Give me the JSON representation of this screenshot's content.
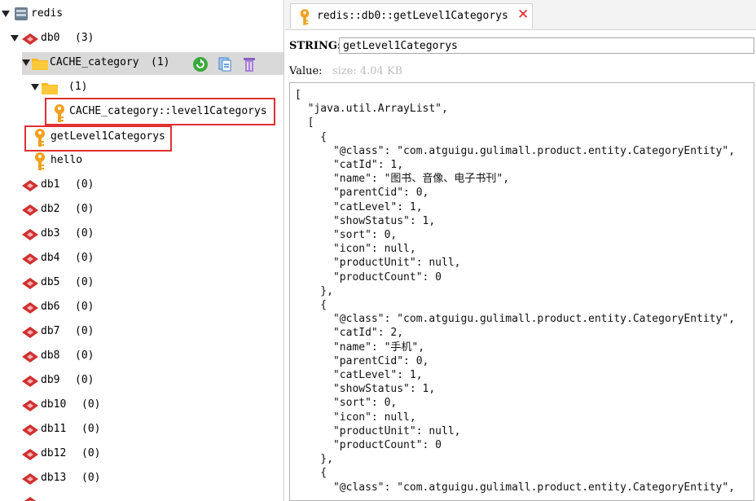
{
  "tree": {
    "root_label": "redis",
    "db0": {
      "label": "db0",
      "count": "(3)"
    },
    "cache_folder": {
      "label": "CACHE_category",
      "count": "(1)"
    },
    "sub_folder": {
      "count": "(1)"
    },
    "level1_key": "CACHE_category::level1Categorys",
    "getlevel_key": "getLevel1Categorys",
    "hello_key": "hello",
    "databases": [
      {
        "label": "db1",
        "count": "(0)"
      },
      {
        "label": "db2",
        "count": "(0)"
      },
      {
        "label": "db3",
        "count": "(0)"
      },
      {
        "label": "db4",
        "count": "(0)"
      },
      {
        "label": "db5",
        "count": "(0)"
      },
      {
        "label": "db6",
        "count": "(0)"
      },
      {
        "label": "db7",
        "count": "(0)"
      },
      {
        "label": "db8",
        "count": "(0)"
      },
      {
        "label": "db9",
        "count": "(0)"
      },
      {
        "label": "db10",
        "count": "(0)"
      },
      {
        "label": "db11",
        "count": "(0)"
      },
      {
        "label": "db12",
        "count": "(0)"
      },
      {
        "label": "db13",
        "count": "(0)"
      }
    ]
  },
  "tab": {
    "title": "redis::db0::getLevel1Categorys"
  },
  "key_panel": {
    "type_label": "STRING:",
    "key_name": "getLevel1Categorys",
    "value_label": "Value:",
    "size_text": "size: 4.04 KB"
  },
  "value_lines": [
    "[",
    "  \"java.util.ArrayList\",",
    "  [",
    "    {",
    "      \"@class\": \"com.atguigu.gulimall.product.entity.CategoryEntity\",",
    "      \"catId\": 1,",
    "      \"name\": \"图书、音像、电子书刊\",",
    "      \"parentCid\": 0,",
    "      \"catLevel\": 1,",
    "      \"showStatus\": 1,",
    "      \"sort\": 0,",
    "      \"icon\": null,",
    "      \"productUnit\": null,",
    "      \"productCount\": 0",
    "    },",
    "    {",
    "      \"@class\": \"com.atguigu.gulimall.product.entity.CategoryEntity\",",
    "      \"catId\": 2,",
    "      \"name\": \"手机\",",
    "      \"parentCid\": 0,",
    "      \"catLevel\": 1,",
    "      \"showStatus\": 1,",
    "      \"sort\": 0,",
    "      \"icon\": null,",
    "      \"productUnit\": null,",
    "      \"productCount\": 0",
    "    },",
    "    {",
    "      \"@class\": \"com.atguigu.gulimall.product.entity.CategoryEntity\","
  ],
  "colors": {
    "highlight_border": "#e03030",
    "selected_row": "#d9d9d9",
    "key_icon": "#f0a020",
    "db_icon": "#d03030",
    "folder_icon": "#f5b820",
    "close_icon": "#e02a2a",
    "reload_icon": "#3aa83a",
    "copy_icon": "#3a7fd0",
    "delete_icon": "#8a5fc0"
  }
}
